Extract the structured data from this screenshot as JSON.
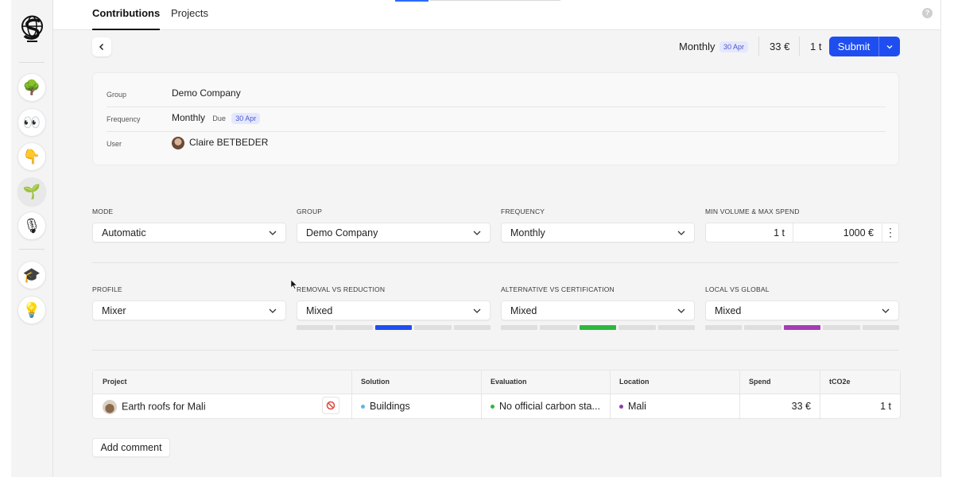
{
  "tabs": [
    {
      "label": "Contributions",
      "active": true
    },
    {
      "label": "Projects",
      "active": false
    }
  ],
  "sidebar": {
    "items": [
      {
        "icon": "tree-icon",
        "glyph": "🌳"
      },
      {
        "icon": "eyes-icon",
        "glyph": "👀"
      },
      {
        "icon": "hand-pointing-icon",
        "glyph": "👇"
      },
      {
        "icon": "seedling-icon",
        "glyph": "🌱",
        "active": true
      },
      {
        "icon": "microphone-icon",
        "glyph": "🎙"
      },
      {
        "icon": "graduation-cap-icon",
        "glyph": "🎓"
      },
      {
        "icon": "light-bulb-icon",
        "glyph": "💡"
      }
    ]
  },
  "action_bar": {
    "frequency": "Monthly",
    "date_badge": "30 Apr",
    "amount": "33 €",
    "volume": "1 t",
    "submit_label": "Submit"
  },
  "info": {
    "rows": [
      {
        "key": "Group",
        "value": "Demo Company"
      },
      {
        "key": "Frequency",
        "value": "Monthly",
        "due_label": "Due",
        "due_date": "30 Apr"
      },
      {
        "key": "User",
        "value": "Claire BETBEDER"
      }
    ]
  },
  "filters": {
    "mode": {
      "label": "MODE",
      "value": "Automatic"
    },
    "group": {
      "label": "GROUP",
      "value": "Demo Company"
    },
    "frequency": {
      "label": "FREQUENCY",
      "value": "Monthly"
    },
    "min_max": {
      "label": "MIN VOLUME & MAX SPEND",
      "volume": "1 t",
      "spend": "1000 €"
    },
    "profile": {
      "label": "PROFILE",
      "value": "Mixer"
    },
    "removal": {
      "label": "REMOVAL VS REDUCTION",
      "value": "Mixed",
      "color": "#1f4ef0",
      "position": 0.5
    },
    "alternative": {
      "label": "ALTERNATIVE VS CERTIFICATION",
      "value": "Mixed",
      "color": "#2db83d",
      "position": 0.5
    },
    "local": {
      "label": "LOCAL VS GLOBAL",
      "value": "Mixed",
      "color": "#a43db5",
      "position": 0.5
    }
  },
  "table": {
    "headers": [
      "Project",
      "Solution",
      "Evaluation",
      "Location",
      "Spend",
      "tCO2e"
    ],
    "rows": [
      {
        "project": "Earth roofs for Mali",
        "solution": "Buildings",
        "solution_color": "#5bb8e8",
        "evaluation": "No official carbon sta...",
        "evaluation_color": "#2db83d",
        "location": "Mali",
        "location_color": "#8e3ea8",
        "spend": "33 €",
        "tco2e": "1 t"
      }
    ]
  },
  "add_comment_label": "Add comment"
}
